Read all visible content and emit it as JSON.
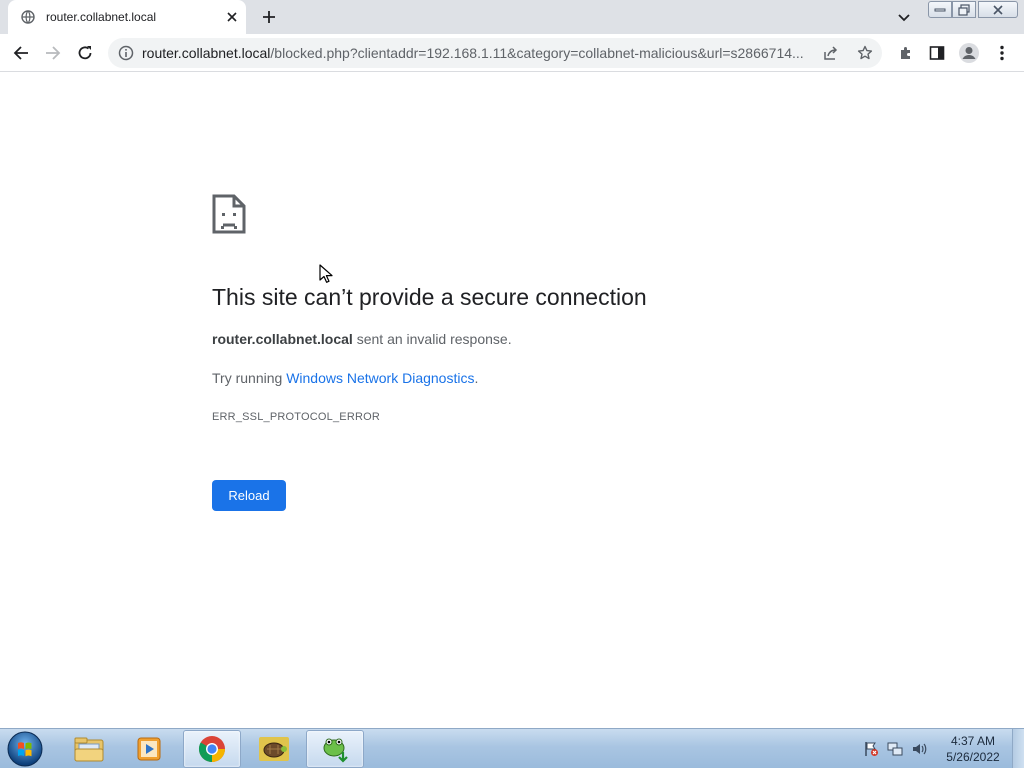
{
  "browser": {
    "tab": {
      "title": "router.collabnet.local",
      "favicon": "globe-icon"
    },
    "new_tab_icon": "plus-icon",
    "tab_search_icon": "chevron-down-icon",
    "window_controls": [
      "minimize-icon",
      "restore-icon",
      "close-icon"
    ]
  },
  "toolbar": {
    "back_icon": "arrow-left-icon",
    "forward_icon": "arrow-right-icon",
    "reload_icon": "reload-icon",
    "url_host": "router.collabnet.local",
    "url_rest": "/blocked.php?clientaddr=192.168.1.11&category=collabnet-malicious&url=s2866714...",
    "site_info_icon": "info-icon",
    "share_icon": "share-icon",
    "bookmark_icon": "star-icon",
    "extensions_icon": "puzzle-icon",
    "side_panel_icon": "side-panel-icon",
    "profile_icon": "profile-icon",
    "menu_icon": "kebab-menu-icon"
  },
  "error": {
    "icon": "sad-document-icon",
    "title": "This site can’t provide a secure connection",
    "summary_host": "router.collabnet.local",
    "summary_text": " sent an invalid response.",
    "suggestion_prefix": "Try running ",
    "suggestion_link": "Windows Network Diagnostics",
    "suggestion_suffix": ".",
    "code": "ERR_SSL_PROTOCOL_ERROR",
    "reload_label": "Reload"
  },
  "taskbar": {
    "apps": [
      {
        "name": "file-explorer-icon",
        "active": false
      },
      {
        "name": "media-player-icon",
        "active": false
      },
      {
        "name": "chrome-icon",
        "active": true
      },
      {
        "name": "turtle-app-icon",
        "active": false
      },
      {
        "name": "frog-app-icon",
        "active": true
      }
    ],
    "tray": [
      "action-center-flag-icon",
      "network-icon",
      "volume-icon"
    ],
    "clock_time": "4:37 AM",
    "clock_date": "5/26/2022"
  },
  "colors": {
    "accent": "#1a73e8",
    "tabstrip": "#dee1e6",
    "omnibox": "#f1f3f4",
    "title_text": "#202124",
    "body_text": "#5f6368"
  }
}
